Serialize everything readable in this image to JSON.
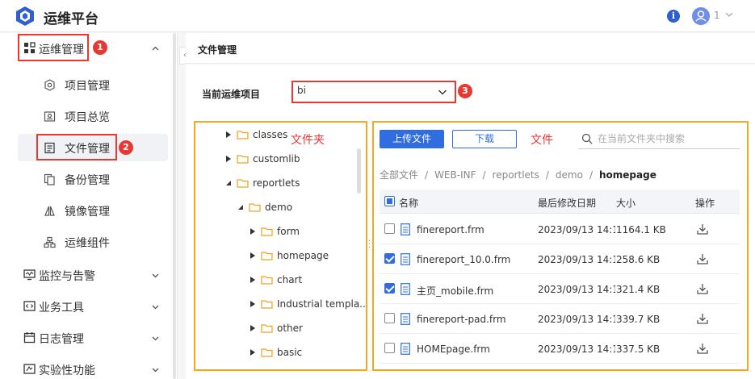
{
  "app": {
    "title": "运维平台",
    "user_count": "1"
  },
  "sidebar": {
    "groups": [
      {
        "label": "运维管理",
        "icon": "grid-icon",
        "expanded": true
      },
      {
        "label": "监控与告警",
        "icon": "monitor-icon"
      },
      {
        "label": "业务工具",
        "icon": "code-icon"
      },
      {
        "label": "日志管理",
        "icon": "calendar-icon"
      },
      {
        "label": "实验性功能",
        "icon": "flask-icon"
      }
    ],
    "items": [
      {
        "label": "项目管理",
        "icon": "gear-icon"
      },
      {
        "label": "项目总览",
        "icon": "overview-icon"
      },
      {
        "label": "文件管理",
        "icon": "file-icon",
        "active": true
      },
      {
        "label": "备份管理",
        "icon": "copy-icon"
      },
      {
        "label": "镜像管理",
        "icon": "mirror-icon"
      },
      {
        "label": "运维组件",
        "icon": "components-icon"
      }
    ]
  },
  "annotations": {
    "badge1": "1",
    "badge2": "2",
    "badge3": "3",
    "folder_label": "文件夹",
    "file_label": "文件",
    "accent_red": "#e53935",
    "accent_orange": "#f5a623"
  },
  "header": {
    "breadcrumb": "文件管理"
  },
  "project": {
    "label": "当前运维项目",
    "value": "bi"
  },
  "tree": [
    {
      "name": "classes",
      "expanded": false
    },
    {
      "name": "customlib",
      "expanded": false
    },
    {
      "name": "reportlets",
      "expanded": true
    },
    {
      "name": "demo",
      "expanded": true
    },
    {
      "name": "form",
      "expanded": false
    },
    {
      "name": "homepage",
      "expanded": false
    },
    {
      "name": "chart",
      "expanded": false
    },
    {
      "name": "Industrial templa...",
      "expanded": false
    },
    {
      "name": "other",
      "expanded": false
    },
    {
      "name": "basic",
      "expanded": false
    }
  ],
  "files": {
    "upload_label": "上传文件",
    "download_label": "下载",
    "search_placeholder": "在当前文件夹中搜索",
    "path": [
      "全部文件",
      "WEB-INF",
      "reportlets",
      "demo",
      "homepage"
    ],
    "columns": {
      "name": "名称",
      "modified": "最后修改日期",
      "size": "大小",
      "actions": "操作"
    },
    "rows": [
      {
        "name": "finereport.frm",
        "modified": "2023/09/13 14:1...",
        "size": "1164.1 KB",
        "checked": false
      },
      {
        "name": "finereport_10.0.frm",
        "modified": "2023/09/13 14:1...",
        "size": "258.6 KB",
        "checked": true
      },
      {
        "name": "主页_mobile.frm",
        "modified": "2023/09/13 14:1...",
        "size": "321.4 KB",
        "checked": true
      },
      {
        "name": "finereport-pad.frm",
        "modified": "2023/09/13 14:1...",
        "size": "339.7 KB",
        "checked": false
      },
      {
        "name": "HOMEpage.frm",
        "modified": "2023/09/13 14:1...",
        "size": "337.5 KB",
        "checked": false
      }
    ]
  }
}
